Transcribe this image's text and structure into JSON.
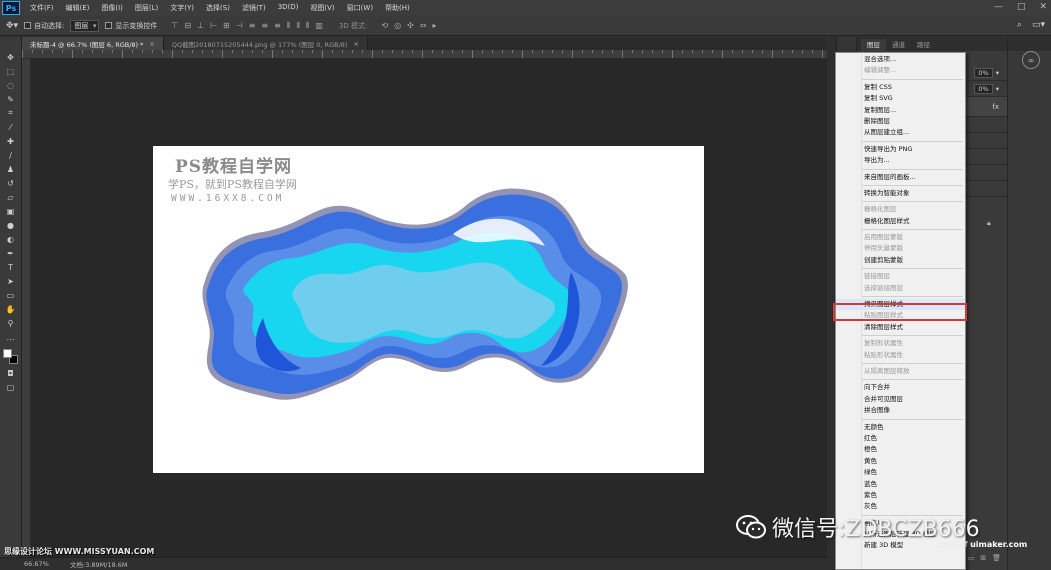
{
  "app": {
    "logo": "Ps",
    "menus": [
      "文件(F)",
      "编辑(E)",
      "图像(I)",
      "图层(L)",
      "文字(Y)",
      "选择(S)",
      "滤镜(T)",
      "3D(D)",
      "视图(V)",
      "窗口(W)",
      "帮助(H)"
    ],
    "window_controls": [
      "—",
      "□",
      "✕"
    ]
  },
  "options_bar": {
    "auto_select_label": "自动选择:",
    "auto_select_value": "图层",
    "show_transform_label": "显示变换控件",
    "mode_3d_label": "3D 模式:"
  },
  "tabs": [
    {
      "label": "未标题-4 @ 66.7% (图层 6, RGB/8) *",
      "close": "×"
    },
    {
      "label": "QQ截图20180715205444.png @ 177% (图层 0, RGB/8)",
      "close": "×"
    }
  ],
  "canvas": {
    "watermark_title": "PS教程自学网",
    "watermark_subtitle": "学PS，就到PS教程自学网",
    "watermark_url": "WWW.16XX8.COM"
  },
  "status": {
    "zoom": "66.67%",
    "doc_size": "文档:3.89M/18.6M"
  },
  "bottom_watermark": "思缘设计论坛 WWW.MISSYUAN.COM",
  "layers_panel": {
    "tabs": [
      "图层",
      "通道",
      "路径"
    ],
    "opacity_value": "0%",
    "fill_value": "0%",
    "fx_label": "fx"
  },
  "context_menu": {
    "items": [
      {
        "label": "混合选项...",
        "disabled": false
      },
      {
        "label": "编辑调整...",
        "disabled": true
      },
      {
        "sep": true
      },
      {
        "label": "复制 CSS",
        "disabled": false
      },
      {
        "label": "复制 SVG",
        "disabled": false
      },
      {
        "label": "复制图层...",
        "disabled": false
      },
      {
        "label": "删除图层",
        "disabled": false
      },
      {
        "label": "从图层建立组...",
        "disabled": false
      },
      {
        "sep": true
      },
      {
        "label": "快速导出为 PNG",
        "disabled": false
      },
      {
        "label": "导出为...",
        "disabled": false
      },
      {
        "sep": true
      },
      {
        "label": "来自图层的画板...",
        "disabled": false
      },
      {
        "sep": true
      },
      {
        "label": "转换为智能对象",
        "disabled": false
      },
      {
        "sep": true
      },
      {
        "label": "栅格化图层",
        "disabled": true
      },
      {
        "label": "栅格化图层样式",
        "disabled": false
      },
      {
        "sep": true
      },
      {
        "label": "启用图层蒙版",
        "disabled": true
      },
      {
        "label": "停用矢量蒙版",
        "disabled": true
      },
      {
        "label": "创建剪贴蒙版",
        "disabled": false
      },
      {
        "sep": true
      },
      {
        "label": "链接图层",
        "disabled": true
      },
      {
        "label": "选择链接图层",
        "disabled": true
      },
      {
        "sep": true
      },
      {
        "label": "拷贝图层样式",
        "disabled": false,
        "highlight": true
      },
      {
        "label": "粘贴图层样式",
        "disabled": true
      },
      {
        "label": "清除图层样式",
        "disabled": false
      },
      {
        "sep": true
      },
      {
        "label": "复制形状属性",
        "disabled": true
      },
      {
        "label": "粘贴形状属性",
        "disabled": true
      },
      {
        "sep": true
      },
      {
        "label": "从隔离图层释放",
        "disabled": true
      },
      {
        "sep": true
      },
      {
        "label": "向下合并",
        "disabled": false
      },
      {
        "label": "合并可见图层",
        "disabled": false
      },
      {
        "label": "拼合图像",
        "disabled": false
      },
      {
        "sep": true
      },
      {
        "label": "无颜色",
        "disabled": false
      },
      {
        "label": "红色",
        "disabled": false
      },
      {
        "label": "橙色",
        "disabled": false
      },
      {
        "label": "黄色",
        "disabled": false
      },
      {
        "label": "绿色",
        "disabled": false
      },
      {
        "label": "蓝色",
        "disabled": false
      },
      {
        "label": "紫色",
        "disabled": false
      },
      {
        "label": "灰色",
        "disabled": false
      },
      {
        "sep": true
      },
      {
        "label": "明信片",
        "disabled": false
      },
      {
        "label": "从所选图层新建 3D 模型",
        "disabled": false
      },
      {
        "label": "新建 3D 模型",
        "disabled": false
      }
    ]
  },
  "wechat_watermark": "微信号:ZDBCZB666",
  "post_watermark": {
    "prefix": "post of ",
    "site": "uimaker.com"
  },
  "colors": {
    "accent_highlight": "#d13a3a",
    "art_dark_blue": "#3a6fe0",
    "art_mid_blue": "#5a8de8",
    "art_cyan": "#19d6f0",
    "art_light_blue": "#6fcdee"
  }
}
